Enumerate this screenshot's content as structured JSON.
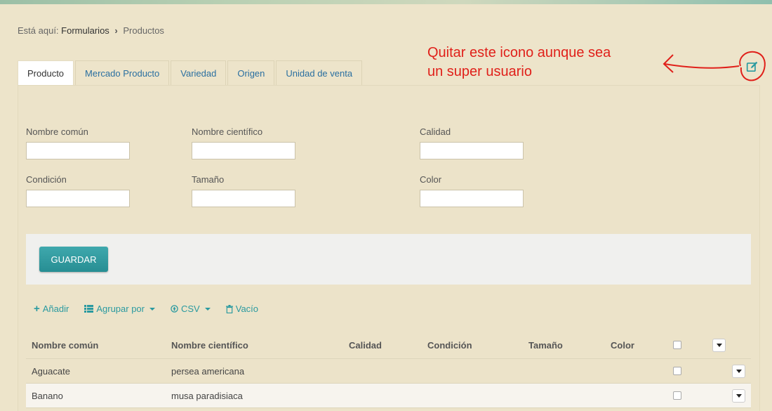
{
  "breadcrumb": {
    "prefix": "Está aquí:",
    "items": [
      "Formularios",
      "Productos"
    ]
  },
  "annotation": {
    "line1": "Quitar este icono aunque sea",
    "line2": "un super usuario",
    "color": "#e0201a"
  },
  "tabs": [
    "Producto",
    "Mercado Producto",
    "Variedad",
    "Origen",
    "Unidad de venta"
  ],
  "form": {
    "fields": [
      {
        "label": "Nombre común",
        "value": ""
      },
      {
        "label": "Nombre científico",
        "value": ""
      },
      {
        "label": "Calidad",
        "value": ""
      },
      {
        "label": "Condición",
        "value": ""
      },
      {
        "label": "Tamaño",
        "value": ""
      },
      {
        "label": "Color",
        "value": ""
      }
    ],
    "save_label": "GUARDAR"
  },
  "toolbar": {
    "add": "Añadir",
    "group": "Agrupar por",
    "csv": "CSV",
    "empty": "Vacío"
  },
  "table": {
    "headers": [
      "Nombre común",
      "Nombre científico",
      "Calidad",
      "Condición",
      "Tamaño",
      "Color"
    ],
    "rows": [
      [
        "Aguacate",
        "persea americana",
        "",
        "",
        "",
        ""
      ],
      [
        "Banano",
        "musa paradisiaca",
        "",
        "",
        "",
        ""
      ]
    ]
  },
  "colors": {
    "accent": "#2a9aa0",
    "background": "#ede4ca",
    "link": "#2a6fa0"
  }
}
